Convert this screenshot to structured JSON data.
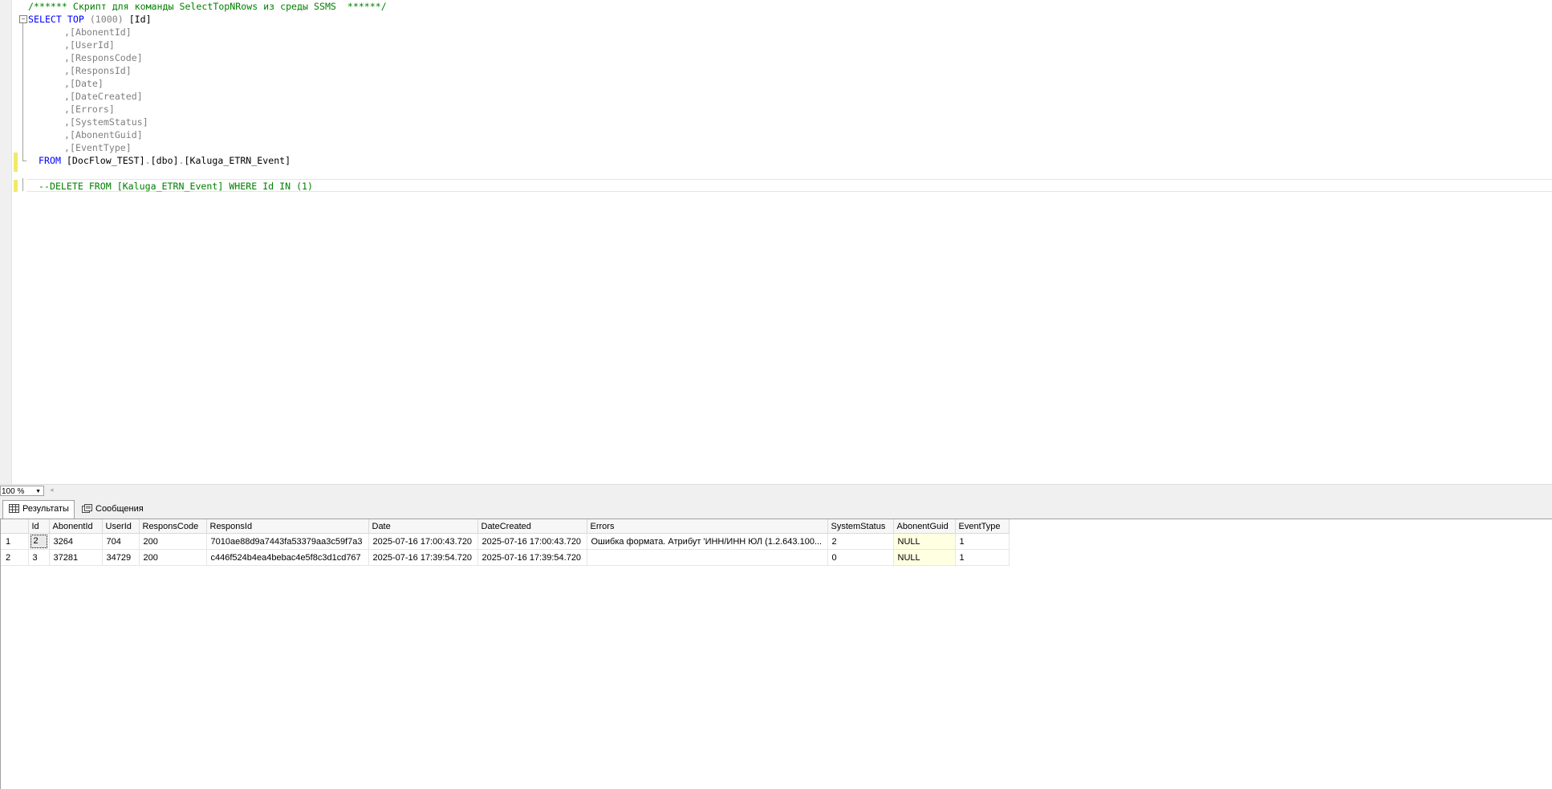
{
  "editor": {
    "comment_line": "/****** Скрипт для команды SelectTopNRows из среды SSMS  ******/",
    "select_kw": "SELECT",
    "top_kw": "TOP",
    "top_count": "(1000)",
    "first_col": "[Id]",
    "columns": [
      ",[AbonentId]",
      ",[UserId]",
      ",[ResponsCode]",
      ",[ResponsId]",
      ",[Date]",
      ",[DateCreated]",
      ",[Errors]",
      ",[SystemStatus]",
      ",[AbonentGuid]",
      ",[EventType]"
    ],
    "from_kw": "FROM",
    "from_db": "[DocFlow_TEST]",
    "from_schema": "[dbo]",
    "from_table": "[Kaluga_ETRN_Event]",
    "delete_comment": "--DELETE FROM [Kaluga_ETRN_Event] WHERE Id IN (1)",
    "collapse_symbol": "−"
  },
  "zoom": {
    "value": "100 %"
  },
  "results_tabs": [
    {
      "label": "Результаты",
      "icon": "grid-icon",
      "active": true
    },
    {
      "label": "Сообщения",
      "icon": "messages-icon",
      "active": false
    }
  ],
  "results": {
    "columns": [
      "Id",
      "AbonentId",
      "UserId",
      "ResponsCode",
      "ResponsId",
      "Date",
      "DateCreated",
      "Errors",
      "SystemStatus",
      "AbonentGuid",
      "EventType"
    ],
    "rows": [
      {
        "num": "1",
        "cells": [
          "2",
          "3264",
          "704",
          "200",
          "7010ae88d9a7443fa53379aa3c59f7a3",
          "2025-07-16 17:00:43.720",
          "2025-07-16 17:00:43.720",
          "Ошибка формата. Атрибут 'ИНН/ИНН ЮЛ (1.2.643.100...",
          "2",
          "NULL",
          "1"
        ]
      },
      {
        "num": "2",
        "cells": [
          "3",
          "37281",
          "34729",
          "200",
          "c446f524b4ea4bebac4e5f8c3d1cd767",
          "2025-07-16 17:39:54.720",
          "2025-07-16 17:39:54.720",
          "",
          "0",
          "NULL",
          "1"
        ]
      }
    ]
  },
  "colors": {
    "keyword": "#0000ff",
    "function": "#ff00ff",
    "comment": "#008000",
    "null_bg": "#ffffe1"
  }
}
